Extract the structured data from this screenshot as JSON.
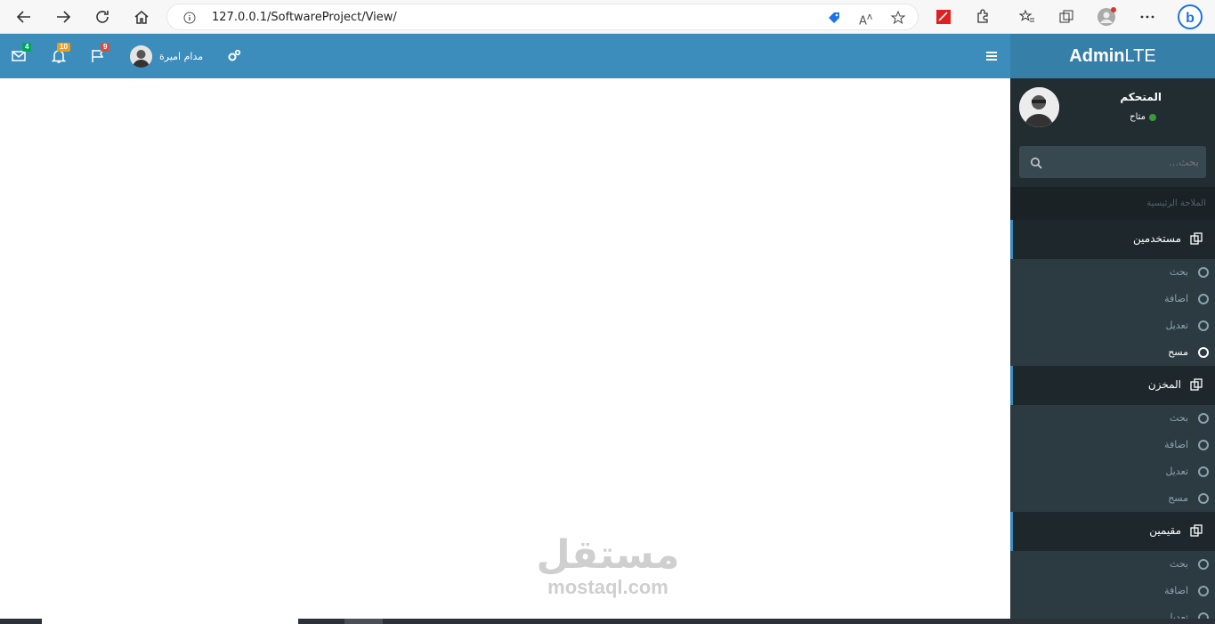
{
  "browser": {
    "url": "127.0.0.1/SoftwareProject/View/"
  },
  "header": {
    "brand_bold": "Admin",
    "brand_light": "LTE",
    "messages_count": "4",
    "notifications_count": "10",
    "tasks_count": "9",
    "user_name": "مدام اميرة"
  },
  "sidebar": {
    "user_name": "المتحكم",
    "status": "متاح",
    "search_placeholder": "بحث...",
    "menu_header": "الملاحة الرئيسية",
    "groups": [
      {
        "label": "مستخدمين",
        "items": [
          "بحث",
          "اضافة",
          "تعديل",
          "مسح"
        ],
        "active_item": 3
      },
      {
        "label": "المخزن",
        "items": [
          "بحث",
          "اضافة",
          "تعديل",
          "مسح"
        ]
      },
      {
        "label": "مقيمين",
        "items": [
          "بحث",
          "اضافة",
          "تعديل"
        ]
      }
    ]
  },
  "watermark": {
    "arabic": "مستقل",
    "latin": "mostaql.com"
  },
  "colors": {
    "header": "#3c8dbc",
    "logo": "#367fa9",
    "sidebar": "#222d32",
    "badge_messages": "#00a65a",
    "badge_notifications": "#f39c12",
    "badge_tasks": "#dd4b39"
  }
}
